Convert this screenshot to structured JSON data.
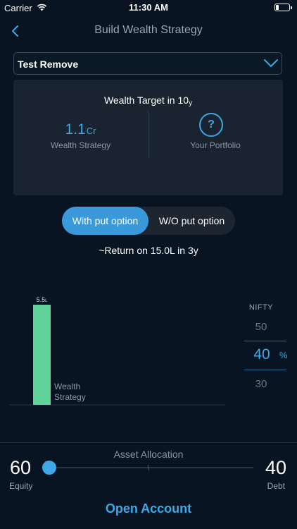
{
  "status_bar": {
    "carrier": "Carrier",
    "time": "11:30 AM"
  },
  "nav": {
    "title": "Build Wealth Strategy",
    "back_icon": "chevron-left-icon"
  },
  "strategy_select": {
    "value": "Test Remove",
    "icon": "chevron-down-icon"
  },
  "target_card": {
    "title_prefix": "Wealth Target in 10",
    "title_suffix": "y",
    "wealth_strategy": {
      "value": "1.1",
      "unit": "Cr",
      "label": "Wealth Strategy"
    },
    "portfolio": {
      "icon_text": "?",
      "label": "Your Portfolio"
    }
  },
  "option_toggle": {
    "with_put": "With put option",
    "without_put": "W/O put option",
    "selected": "with_put"
  },
  "return_line": "~Return on 15.0L in 3y",
  "chart_data": {
    "type": "bar",
    "categories": [
      "Wealth Strategy"
    ],
    "values": [
      5.5
    ],
    "value_label": "5.5",
    "value_unit": "L",
    "category_label_lines": [
      "Wealth",
      "Strategy"
    ],
    "bar_color": "#5fd39a",
    "ylim": [
      0,
      5.5
    ]
  },
  "nifty_picker": {
    "label": "NIFTY",
    "above": "50",
    "selected": "40",
    "below": "30",
    "unit": "%"
  },
  "allocation": {
    "title": "Asset Allocation",
    "equity_value": "60",
    "equity_label": "Equity",
    "debt_value": "40",
    "debt_label": "Debt",
    "equity_fraction": 0.6
  },
  "cta": {
    "open_account": "Open Account"
  },
  "colors": {
    "accent": "#3da9e6",
    "background": "#081421",
    "card": "#1a2430",
    "bar": "#5fd39a"
  }
}
